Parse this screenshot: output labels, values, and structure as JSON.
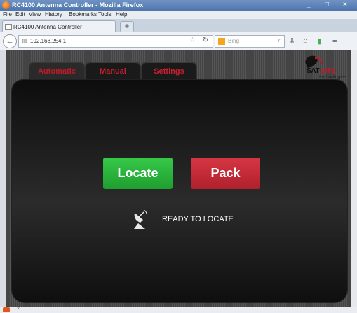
{
  "window": {
    "title": "RC4100 Antenna Controller - Mozilla Firefox",
    "controls": [
      "_",
      "□",
      "×"
    ]
  },
  "menu": {
    "items": [
      "File",
      "Edit",
      "View",
      "History",
      "Bookmarks",
      "Tools",
      "Help"
    ]
  },
  "browser_tab": {
    "title": "RC4100 Antenna Controller",
    "new_tab_label": "+"
  },
  "navbar": {
    "url": "192.168.254.1",
    "search_placeholder": "Bing"
  },
  "app": {
    "tabs": [
      {
        "label": "Automatic",
        "active": true
      },
      {
        "label": "Manual",
        "active": false
      },
      {
        "label": "Settings",
        "active": false
      }
    ],
    "logo": {
      "brand_sat": "SAT-",
      "brand_lite": "LITE",
      "subtitle": "technologies"
    },
    "buttons": {
      "locate_label": "Locate",
      "pack_label": "Pack"
    },
    "status_text": "READY TO LOCATE"
  },
  "statusbar": {
    "close_label": "×"
  },
  "colors": {
    "accent_red": "#c01a27",
    "locate_green": "#2fb83f",
    "pack_red": "#c62a37",
    "panel_bg": "#1b1b1b"
  },
  "icons": [
    "firefox-icon",
    "back-arrow-icon",
    "globe-icon",
    "star-icon",
    "reload-icon",
    "bing-icon",
    "search-icon",
    "download-icon",
    "home-icon",
    "stats-icon",
    "menu-icon",
    "satellite-dish-icon",
    "sat-lite-logo-icon"
  ]
}
